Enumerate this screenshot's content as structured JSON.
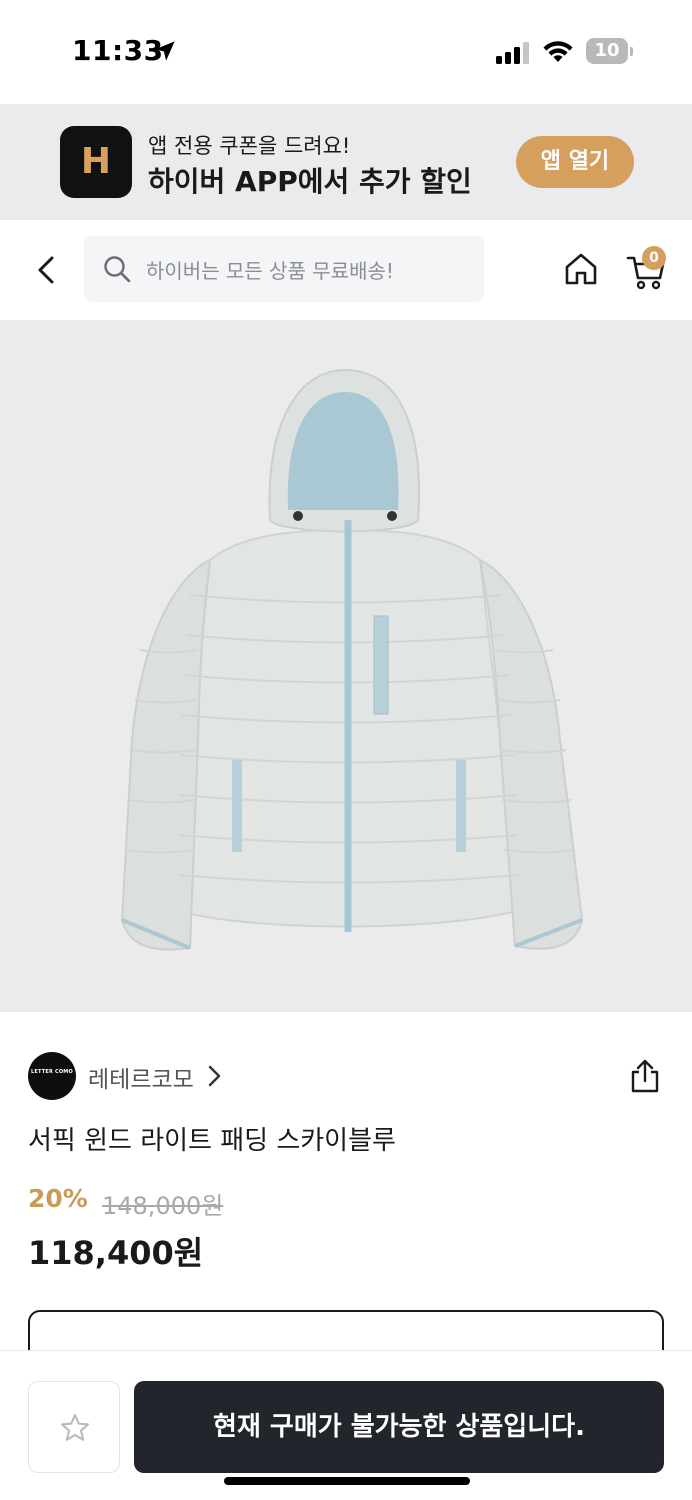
{
  "status_bar": {
    "time": "11:33",
    "battery_level": "10"
  },
  "app_banner": {
    "logo_letter": "H",
    "line1": "앱 전용 쿠폰을 드려요!",
    "line2": "하이버 APP에서 추가 할인",
    "open_button": "앱 열기",
    "accent_color": "#d5a05d"
  },
  "header": {
    "search_placeholder": "하이버는 모든 상품 무료배송!",
    "cart_count": "0"
  },
  "product": {
    "brand_logo_text": "LETTER COMO",
    "brand_name": "레테르코모",
    "name": "서픽 윈드 라이트 패딩 스카이블루",
    "discount_rate": "20%",
    "original_price": "148,000원",
    "sale_price": "118,400원",
    "image_description_icon": "down-jacket"
  },
  "bottom_bar": {
    "buy_button": "현재 구매가 불가능한 상품입니다."
  }
}
